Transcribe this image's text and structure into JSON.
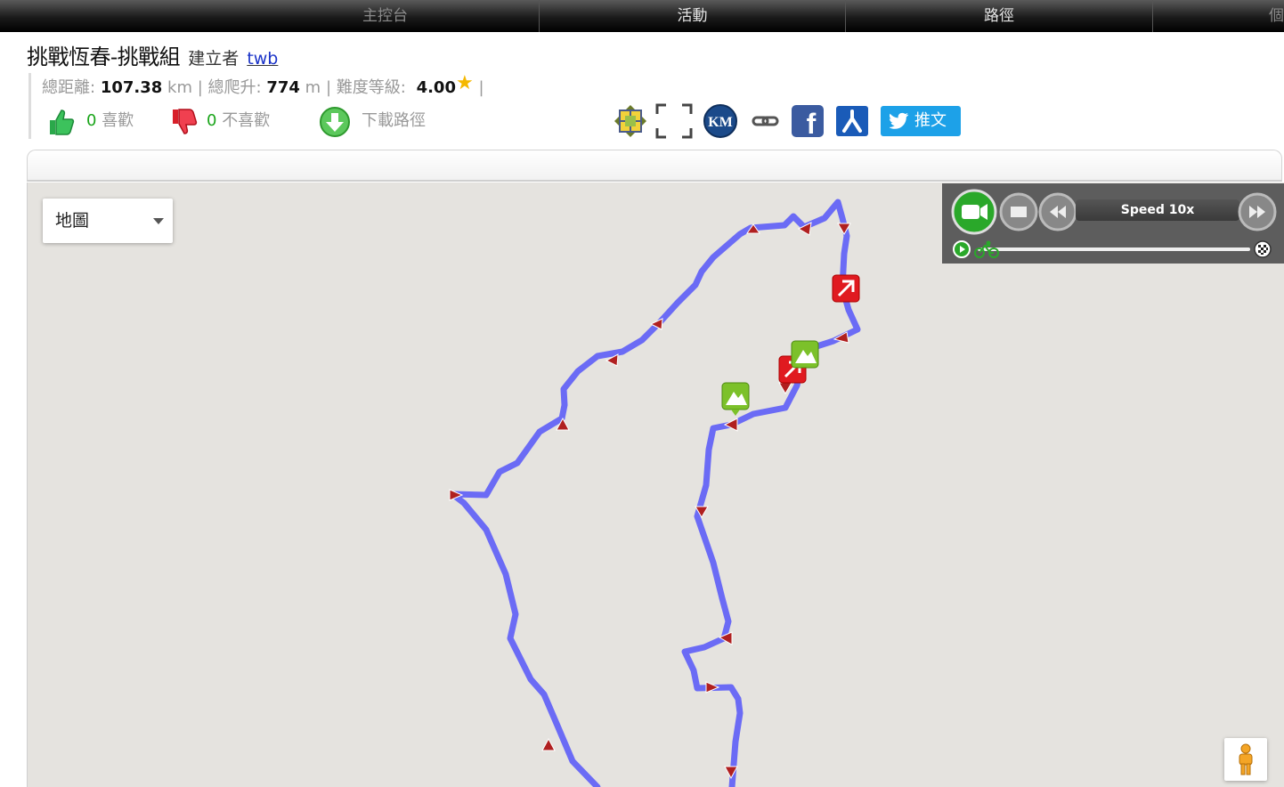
{
  "nav": {
    "tabs": [
      "主控台",
      "活動",
      "路徑",
      "個"
    ]
  },
  "route": {
    "title": "挑戰恆春-挑戰組",
    "creator_label": "建立者",
    "creator_name": "twb"
  },
  "stats": {
    "distance_label": "總距離:",
    "distance_value": "107.38",
    "distance_unit": "km",
    "climb_label": "總爬升:",
    "climb_value": "774",
    "climb_unit": "m",
    "difficulty_label": "難度等級:",
    "difficulty_value": "4.00",
    "sep": "|"
  },
  "reactions": {
    "likes_count": "0",
    "likes_label": "喜歡",
    "dislikes_count": "0",
    "dislikes_label": "不喜歡",
    "download_label": "下載路徑"
  },
  "share": {
    "km_label": "KM",
    "fb_label": "f",
    "tweet_label": "推文"
  },
  "map": {
    "type_selected": "地圖",
    "route_color": "#6b6bf5"
  },
  "player": {
    "speed_label": "Speed 10x"
  }
}
